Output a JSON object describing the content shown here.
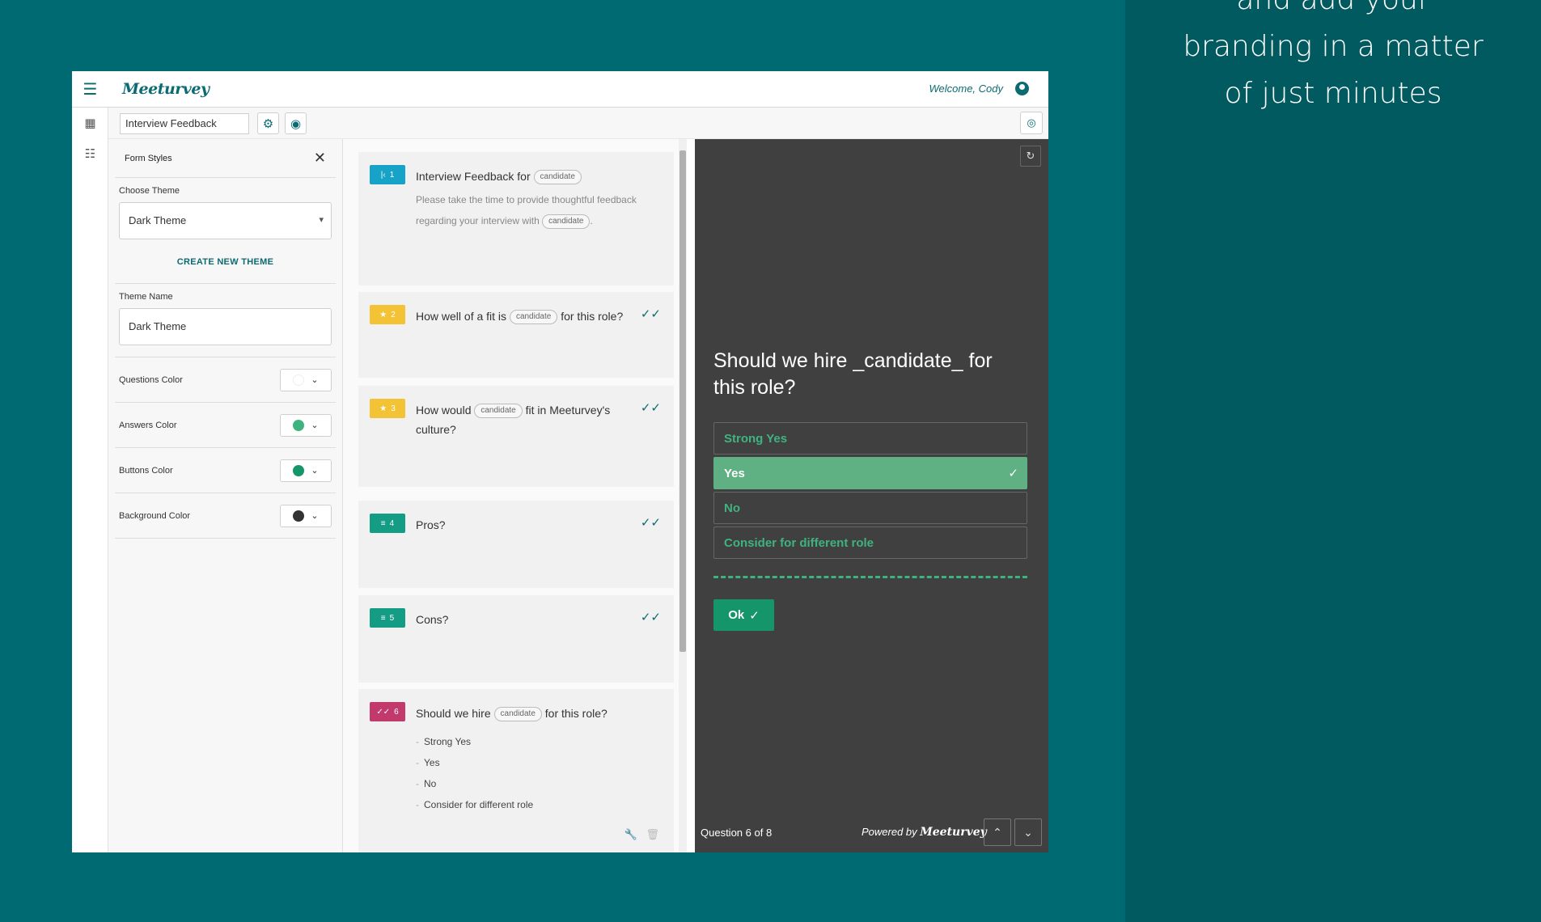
{
  "tagline": "Build beautiful surveys with no code and add your branding in a matter of just minutes",
  "app": {
    "logo": "Meeturvey",
    "welcome": "Welcome, Cody",
    "form_title": "Interview Feedback"
  },
  "styles_panel": {
    "title": "Form Styles",
    "choose_theme_label": "Choose Theme",
    "selected_theme": "Dark Theme",
    "create_theme": "CREATE NEW THEME",
    "theme_name_label": "Theme Name",
    "theme_name_value": "Dark Theme",
    "colors": [
      {
        "label": "Questions Color",
        "swatch": "#ffffff"
      },
      {
        "label": "Answers Color",
        "swatch": "#3fb37f"
      },
      {
        "label": "Buttons Color",
        "swatch": "#15956a"
      },
      {
        "label": "Background Color",
        "swatch": "#333333"
      }
    ]
  },
  "questions": [
    {
      "num": "1",
      "title_before": "Interview Feedback for",
      "chip": "candidate",
      "desc_before": "Please take the time to provide thoughtful feedback regarding your interview with",
      "desc_chip": "candidate",
      "desc_after": "."
    },
    {
      "num": "2",
      "title_before": "How well of a fit is",
      "chip": "candidate",
      "title_after": "for this role?"
    },
    {
      "num": "3",
      "title_before": "How would",
      "chip": "candidate",
      "title_after": "fit in Meeturvey's culture?"
    },
    {
      "num": "4",
      "title": "Pros?"
    },
    {
      "num": "5",
      "title": "Cons?"
    },
    {
      "num": "6",
      "title_before": "Should we hire",
      "chip": "candidate",
      "title_after": "for this role?",
      "options": [
        "Strong Yes",
        "Yes",
        "No",
        "Consider for different role"
      ]
    }
  ],
  "preview": {
    "question": "Should we hire _candidate_ for this role?",
    "options": [
      "Strong Yes",
      "Yes",
      "No",
      "Consider for different role"
    ],
    "selected_index": 1,
    "ok_label": "Ok",
    "counter": "Question 6 of 8",
    "powered_by": "Powered by",
    "powered_brand": "Meeturvey"
  },
  "colors": {
    "brand": "#0b6b72",
    "page_bg": "#006a73",
    "answer": "#3fb37f",
    "preview_bg": "#404041"
  }
}
